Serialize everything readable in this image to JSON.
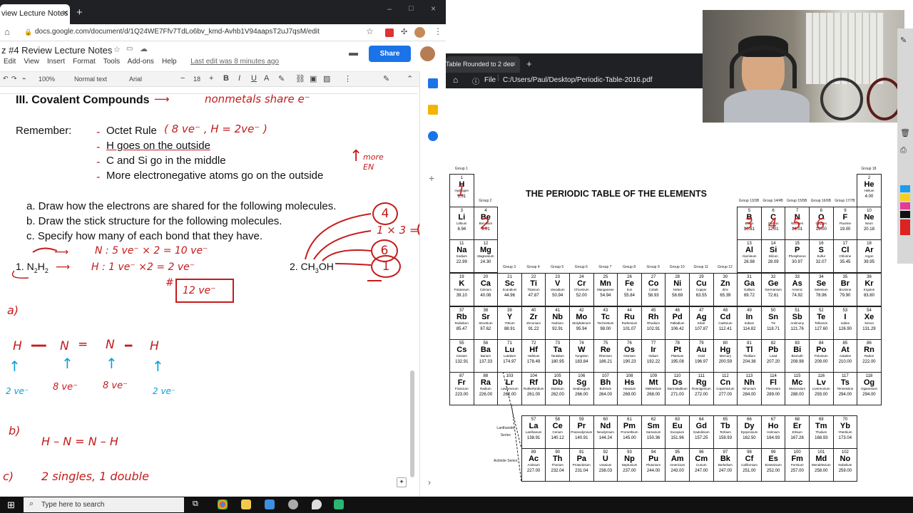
{
  "left_browser": {
    "tab_title": "view Lecture Notes - G",
    "new_tab_icon": "+",
    "url": "docs.google.com/document/d/1Q24WE7Ffv7TdLo6bv_kmd-Avhb1V94aapsT2uJ7qsM/edit",
    "window_controls": [
      "–",
      "□",
      "×"
    ]
  },
  "docs": {
    "title": "z #4 Review Lecture Notes",
    "menu": [
      "Edit",
      "View",
      "Insert",
      "Format",
      "Tools",
      "Add-ons",
      "Help"
    ],
    "last_edit": "Last edit was 8 minutes ago",
    "share_label": "Share",
    "toolbar": {
      "zoom": "100%",
      "style": "Normal text",
      "font": "Arial",
      "size": "18"
    },
    "content": {
      "heading": "III. Covalent Compounds",
      "remember_label": "Remember:",
      "rules": [
        "Octet Rule",
        "H goes on the outside",
        "C and Si go in the middle",
        "More electronegative atoms go on the outside"
      ],
      "tasks": [
        "a. Draw how the electrons are shared for the following molecules.",
        "b. Draw the stick structure for the following molecules.",
        "c. Specify how many of each bond that they have."
      ],
      "mol1_prefix": "1. N",
      "mol1_sub1": "2",
      "mol1_h": "H",
      "mol1_sub2": "2",
      "mol2_prefix": "2. CH",
      "mol2_sub": "3",
      "mol2_suffix": "OH"
    },
    "annotations": {
      "nonmetals": "nonmetals  share e⁻",
      "octet_note": "( 8 ve⁻ ,  H = 2ve⁻ )",
      "more_en": "more EN",
      "n_calc": "N : 5 ve⁻ × 2 =   10 ve⁻",
      "h_calc": "H :  1  ve⁻ ×2  =   2 ve⁻",
      "total": "12 ve⁻",
      "hash": "#",
      "circle_4": "4",
      "calc_1x3": "1 × 3 =",
      "circle_3": "3",
      "circle_6": "6",
      "circle_1": "1",
      "part_a": "a)",
      "lewis_atoms": [
        "H",
        "N",
        "N",
        "H"
      ],
      "lewis_labels": [
        "2 ve⁻",
        "8 ve⁻",
        "8 ve⁻",
        "2 ve⁻"
      ],
      "part_b": "b)",
      "stick": "H  –  N  =  N  –  H",
      "part_c": "c)",
      "bond_count": "2 singles,  1 double"
    }
  },
  "pdf_viewer": {
    "tab_title": "Table Rounded to 2 dec",
    "new_tab_icon": "+",
    "file_label": "File",
    "path": "C:/Users/Paul/Desktop/Periodic-Table-2016.pdf"
  },
  "periodic_table": {
    "title": "THE PERIODIC TABLE OF THE ELEMENTS",
    "group_labels": [
      "Group 1",
      "Group 2",
      "Group 3",
      "Group 4",
      "Group 5",
      "Group 6",
      "Group 7",
      "Group 8",
      "Group 9",
      "Group 10",
      "Group 11",
      "Group 12",
      "Group 13/3B",
      "Group 14/4B",
      "Group 15/5B",
      "Group 16/6B",
      "Group 17/7B",
      "Group 18"
    ],
    "lanthanide_label": "Lanthanide Series",
    "actinide_label": "Actinide Series",
    "elements": [
      [
        1,
        "H",
        "Hydrogen",
        "1.01",
        1,
        1
      ],
      [
        2,
        "He",
        "Helium",
        "4.00",
        18,
        1
      ],
      [
        3,
        "Li",
        "Lithium",
        "6.94",
        1,
        2
      ],
      [
        4,
        "Be",
        "Beryllium",
        "9.01",
        2,
        2
      ],
      [
        5,
        "B",
        "Boron",
        "10.81",
        13,
        2
      ],
      [
        6,
        "C",
        "Carbon",
        "12.01",
        14,
        2
      ],
      [
        7,
        "N",
        "Nitrogen",
        "14.01",
        15,
        2
      ],
      [
        8,
        "O",
        "Oxygen",
        "16.00",
        16,
        2
      ],
      [
        9,
        "F",
        "Fluorine",
        "19.00",
        17,
        2
      ],
      [
        10,
        "Ne",
        "Neon",
        "20.18",
        18,
        2
      ],
      [
        11,
        "Na",
        "Sodium",
        "22.99",
        1,
        3
      ],
      [
        12,
        "Mg",
        "Magnesium",
        "24.30",
        2,
        3
      ],
      [
        13,
        "Al",
        "Aluminum",
        "26.98",
        13,
        3
      ],
      [
        14,
        "Si",
        "Silicon",
        "28.09",
        14,
        3
      ],
      [
        15,
        "P",
        "Phosphorus",
        "30.97",
        15,
        3
      ],
      [
        16,
        "S",
        "Sulfur",
        "32.07",
        16,
        3
      ],
      [
        17,
        "Cl",
        "Chlorine",
        "35.45",
        17,
        3
      ],
      [
        18,
        "Ar",
        "Argon",
        "39.95",
        18,
        3
      ],
      [
        19,
        "K",
        "Potassium",
        "39.10",
        1,
        4
      ],
      [
        20,
        "Ca",
        "Calcium",
        "40.08",
        2,
        4
      ],
      [
        21,
        "Sc",
        "Scandium",
        "44.96",
        3,
        4
      ],
      [
        22,
        "Ti",
        "Titanium",
        "47.87",
        4,
        4
      ],
      [
        23,
        "V",
        "Vanadium",
        "50.94",
        5,
        4
      ],
      [
        24,
        "Cr",
        "Chromium",
        "52.00",
        6,
        4
      ],
      [
        25,
        "Mn",
        "Manganese",
        "54.94",
        7,
        4
      ],
      [
        26,
        "Fe",
        "Iron",
        "55.84",
        8,
        4
      ],
      [
        27,
        "Co",
        "Cobalt",
        "58.93",
        9,
        4
      ],
      [
        28,
        "Ni",
        "Nickel",
        "58.69",
        10,
        4
      ],
      [
        29,
        "Cu",
        "Copper",
        "63.55",
        11,
        4
      ],
      [
        30,
        "Zn",
        "Zinc",
        "65.39",
        12,
        4
      ],
      [
        31,
        "Ga",
        "Gallium",
        "69.72",
        13,
        4
      ],
      [
        32,
        "Ge",
        "Germanium",
        "72.61",
        14,
        4
      ],
      [
        33,
        "As",
        "Arsenic",
        "74.92",
        15,
        4
      ],
      [
        34,
        "Se",
        "Selenium",
        "78.96",
        16,
        4
      ],
      [
        35,
        "Br",
        "Bromine",
        "79.90",
        17,
        4
      ],
      [
        36,
        "Kr",
        "Krypton",
        "83.80",
        18,
        4
      ],
      [
        37,
        "Rb",
        "Rubidium",
        "85.47",
        1,
        5
      ],
      [
        38,
        "Sr",
        "Strontium",
        "87.62",
        2,
        5
      ],
      [
        39,
        "Y",
        "Yttrium",
        "88.91",
        3,
        5
      ],
      [
        40,
        "Zr",
        "Zirconium",
        "91.22",
        4,
        5
      ],
      [
        41,
        "Nb",
        "Niobium",
        "92.91",
        5,
        5
      ],
      [
        42,
        "Mo",
        "Molybdenum",
        "95.94",
        6,
        5
      ],
      [
        43,
        "Tc",
        "Technetium",
        "98.00",
        7,
        5
      ],
      [
        44,
        "Ru",
        "Ruthenium",
        "101.07",
        8,
        5
      ],
      [
        45,
        "Rh",
        "Rhodium",
        "102.91",
        9,
        5
      ],
      [
        46,
        "Pd",
        "Palladium",
        "106.42",
        10,
        5
      ],
      [
        47,
        "Ag",
        "Silver",
        "107.87",
        11,
        5
      ],
      [
        48,
        "Cd",
        "Cadmium",
        "112.41",
        12,
        5
      ],
      [
        49,
        "In",
        "Indium",
        "114.82",
        13,
        5
      ],
      [
        50,
        "Sn",
        "Tin",
        "118.71",
        14,
        5
      ],
      [
        51,
        "Sb",
        "Antimony",
        "121.76",
        15,
        5
      ],
      [
        52,
        "Te",
        "Tellurium",
        "127.60",
        16,
        5
      ],
      [
        53,
        "I",
        "Iodine",
        "126.90",
        17,
        5
      ],
      [
        54,
        "Xe",
        "Xenon",
        "131.29",
        18,
        5
      ],
      [
        55,
        "Cs",
        "Cesium",
        "132.91",
        1,
        6
      ],
      [
        56,
        "Ba",
        "Barium",
        "137.33",
        2,
        6
      ],
      [
        71,
        "Lu",
        "Lutetium",
        "174.97",
        3,
        6
      ],
      [
        72,
        "Hf",
        "Hafnium",
        "178.49",
        4,
        6
      ],
      [
        73,
        "Ta",
        "Tantalum",
        "180.95",
        5,
        6
      ],
      [
        74,
        "W",
        "Tungsten",
        "183.84",
        6,
        6
      ],
      [
        75,
        "Re",
        "Rhenium",
        "186.21",
        7,
        6
      ],
      [
        76,
        "Os",
        "Osmium",
        "190.23",
        8,
        6
      ],
      [
        77,
        "Ir",
        "Iridium",
        "192.22",
        9,
        6
      ],
      [
        78,
        "Pt",
        "Platinum",
        "195.08",
        10,
        6
      ],
      [
        79,
        "Au",
        "Gold",
        "196.97",
        11,
        6
      ],
      [
        80,
        "Hg",
        "Mercury",
        "200.59",
        12,
        6
      ],
      [
        81,
        "Tl",
        "Thallium",
        "204.38",
        13,
        6
      ],
      [
        82,
        "Pb",
        "Lead",
        "207.20",
        14,
        6
      ],
      [
        83,
        "Bi",
        "Bismuth",
        "208.98",
        15,
        6
      ],
      [
        84,
        "Po",
        "Polonium",
        "209.00",
        16,
        6
      ],
      [
        85,
        "At",
        "Astatine",
        "210.00",
        17,
        6
      ],
      [
        86,
        "Rn",
        "Radon",
        "222.00",
        18,
        6
      ],
      [
        87,
        "Fr",
        "Francium",
        "223.00",
        1,
        7
      ],
      [
        88,
        "Ra",
        "Radium",
        "226.00",
        2,
        7
      ],
      [
        103,
        "Lr",
        "Lawrencium",
        "262.00",
        3,
        7
      ],
      [
        104,
        "Rf",
        "Rutherfordium",
        "261.00",
        4,
        7
      ],
      [
        105,
        "Db",
        "Dubnium",
        "262.00",
        5,
        7
      ],
      [
        106,
        "Sg",
        "Seaborgium",
        "266.00",
        6,
        7
      ],
      [
        107,
        "Bh",
        "Bohrium",
        "264.00",
        7,
        7
      ],
      [
        108,
        "Hs",
        "Hassium",
        "269.00",
        8,
        7
      ],
      [
        109,
        "Mt",
        "Meitnerium",
        "268.00",
        9,
        7
      ],
      [
        110,
        "Ds",
        "Darmstadtium",
        "271.00",
        10,
        7
      ],
      [
        111,
        "Rg",
        "Roentgenium",
        "272.00",
        11,
        7
      ],
      [
        112,
        "Cn",
        "Copernicium",
        "277.00",
        12,
        7
      ],
      [
        113,
        "Nh",
        "Nihonium",
        "284.00",
        13,
        7
      ],
      [
        114,
        "Fl",
        "Flerovium",
        "289.00",
        14,
        7
      ],
      [
        115,
        "Mc",
        "Moscovium",
        "288.00",
        15,
        7
      ],
      [
        116,
        "Lv",
        "Livermorium",
        "293.00",
        16,
        7
      ],
      [
        117,
        "Ts",
        "Tennessine",
        "294.00",
        17,
        7
      ],
      [
        118,
        "Og",
        "Oganesson",
        "294.00",
        18,
        7
      ],
      [
        57,
        "La",
        "Lanthanum",
        "138.91",
        4,
        9
      ],
      [
        58,
        "Ce",
        "Cerium",
        "140.12",
        5,
        9
      ],
      [
        59,
        "Pr",
        "Praseodymium",
        "140.91",
        6,
        9
      ],
      [
        60,
        "Nd",
        "Neodymium",
        "144.24",
        7,
        9
      ],
      [
        61,
        "Pm",
        "Promethium",
        "145.00",
        8,
        9
      ],
      [
        62,
        "Sm",
        "Samarium",
        "150.36",
        9,
        9
      ],
      [
        63,
        "Eu",
        "Europium",
        "151.96",
        10,
        9
      ],
      [
        64,
        "Gd",
        "Gadolinium",
        "157.25",
        11,
        9
      ],
      [
        65,
        "Tb",
        "Terbium",
        "158.93",
        12,
        9
      ],
      [
        66,
        "Dy",
        "Dysprosium",
        "162.50",
        13,
        9
      ],
      [
        67,
        "Ho",
        "Holmium",
        "164.93",
        14,
        9
      ],
      [
        68,
        "Er",
        "Erbium",
        "167.26",
        15,
        9
      ],
      [
        69,
        "Tm",
        "Thulium",
        "168.93",
        16,
        9
      ],
      [
        70,
        "Yb",
        "Ytterbium",
        "173.04",
        17,
        9
      ],
      [
        89,
        "Ac",
        "Actinium",
        "227.00",
        4,
        10
      ],
      [
        90,
        "Th",
        "Thorium",
        "232.04",
        5,
        10
      ],
      [
        91,
        "Pa",
        "Protactinium",
        "231.04",
        6,
        10
      ],
      [
        92,
        "U",
        "Uranium",
        "238.03",
        7,
        10
      ],
      [
        93,
        "Np",
        "Neptunium",
        "237.00",
        8,
        10
      ],
      [
        94,
        "Pu",
        "Plutonium",
        "244.00",
        9,
        10
      ],
      [
        95,
        "Am",
        "Americium",
        "243.00",
        10,
        10
      ],
      [
        96,
        "Cm",
        "Curium",
        "247.00",
        11,
        10
      ],
      [
        97,
        "Bk",
        "Berkelium",
        "247.00",
        12,
        10
      ],
      [
        98,
        "Cf",
        "Californium",
        "251.00",
        13,
        10
      ],
      [
        99,
        "Es",
        "Einsteinium",
        "252.00",
        14,
        10
      ],
      [
        100,
        "Fm",
        "Fermium",
        "257.00",
        15,
        10
      ],
      [
        101,
        "Md",
        "Mendelevium",
        "258.00",
        16,
        10
      ],
      [
        102,
        "No",
        "Nobelium",
        "259.00",
        17,
        10
      ]
    ],
    "valence_marks": [
      [
        "1",
        1,
        1
      ],
      [
        "2",
        2,
        2
      ],
      [
        "3",
        13,
        2
      ],
      [
        "4",
        14,
        2
      ],
      [
        "5",
        15,
        2
      ],
      [
        "6",
        16,
        2
      ]
    ]
  },
  "taskbar": {
    "search_placeholder": "Type here to search"
  }
}
